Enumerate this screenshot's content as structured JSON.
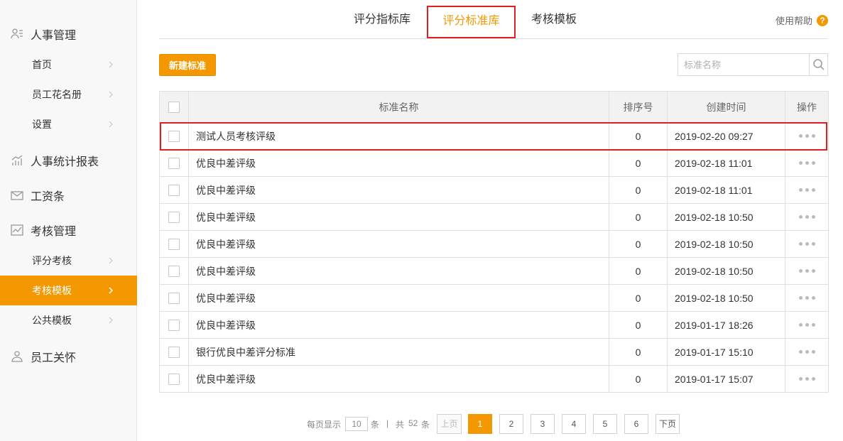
{
  "sidebar": {
    "groups": [
      {
        "label": "人事管理",
        "icon": "person-card-icon"
      },
      {
        "label": "人事统计报表",
        "icon": "bar-chart-icon"
      },
      {
        "label": "工资条",
        "icon": "envelope-icon"
      },
      {
        "label": "考核管理",
        "icon": "line-chart-icon"
      },
      {
        "label": "员工关怀",
        "icon": "people-icon"
      }
    ],
    "subitems": [
      {
        "label": "首页"
      },
      {
        "label": "员工花名册"
      },
      {
        "label": "设置"
      },
      {
        "label": "评分考核"
      },
      {
        "label": "考核模板"
      },
      {
        "label": "公共模板"
      }
    ],
    "active_item": "考核模板"
  },
  "tabs": [
    {
      "label": "评分指标库"
    },
    {
      "label": "评分标准库"
    },
    {
      "label": "考核模板"
    }
  ],
  "active_tab": "评分标准库",
  "help": {
    "label": "使用帮助",
    "icon_text": "?"
  },
  "toolbar": {
    "new_label": "新建标准"
  },
  "search": {
    "placeholder": "标准名称",
    "value": ""
  },
  "table": {
    "headers": {
      "name": "标准名称",
      "order": "排序号",
      "created": "创建时间",
      "ops": "操作"
    },
    "rows": [
      {
        "name": "测试人员考核评级",
        "order": "0",
        "created": "2019-02-20 09:27"
      },
      {
        "name": "优良中差评级",
        "order": "0",
        "created": "2019-02-18 11:01"
      },
      {
        "name": "优良中差评级",
        "order": "0",
        "created": "2019-02-18 11:01"
      },
      {
        "name": "优良中差评级",
        "order": "0",
        "created": "2019-02-18 10:50"
      },
      {
        "name": "优良中差评级",
        "order": "0",
        "created": "2019-02-18 10:50"
      },
      {
        "name": "优良中差评级",
        "order": "0",
        "created": "2019-02-18 10:50"
      },
      {
        "name": "优良中差评级",
        "order": "0",
        "created": "2019-02-18 10:50"
      },
      {
        "name": "优良中差评级",
        "order": "0",
        "created": "2019-01-17 18:26"
      },
      {
        "name": "银行优良中差评分标准",
        "order": "0",
        "created": "2019-01-17 15:10"
      },
      {
        "name": "优良中差评级",
        "order": "0",
        "created": "2019-01-17 15:07"
      }
    ]
  },
  "pagination": {
    "per_page_label": "每页显示",
    "per_page_value": "10",
    "per_page_unit": "条",
    "separator": "|",
    "total_prefix": "共",
    "total": "52",
    "total_unit": "条",
    "prev": "上页",
    "pages": [
      "1",
      "2",
      "3",
      "4",
      "5",
      "6"
    ],
    "current": "1",
    "next": "下页"
  },
  "colors": {
    "accent": "#f39800",
    "highlight": "#e02020"
  }
}
